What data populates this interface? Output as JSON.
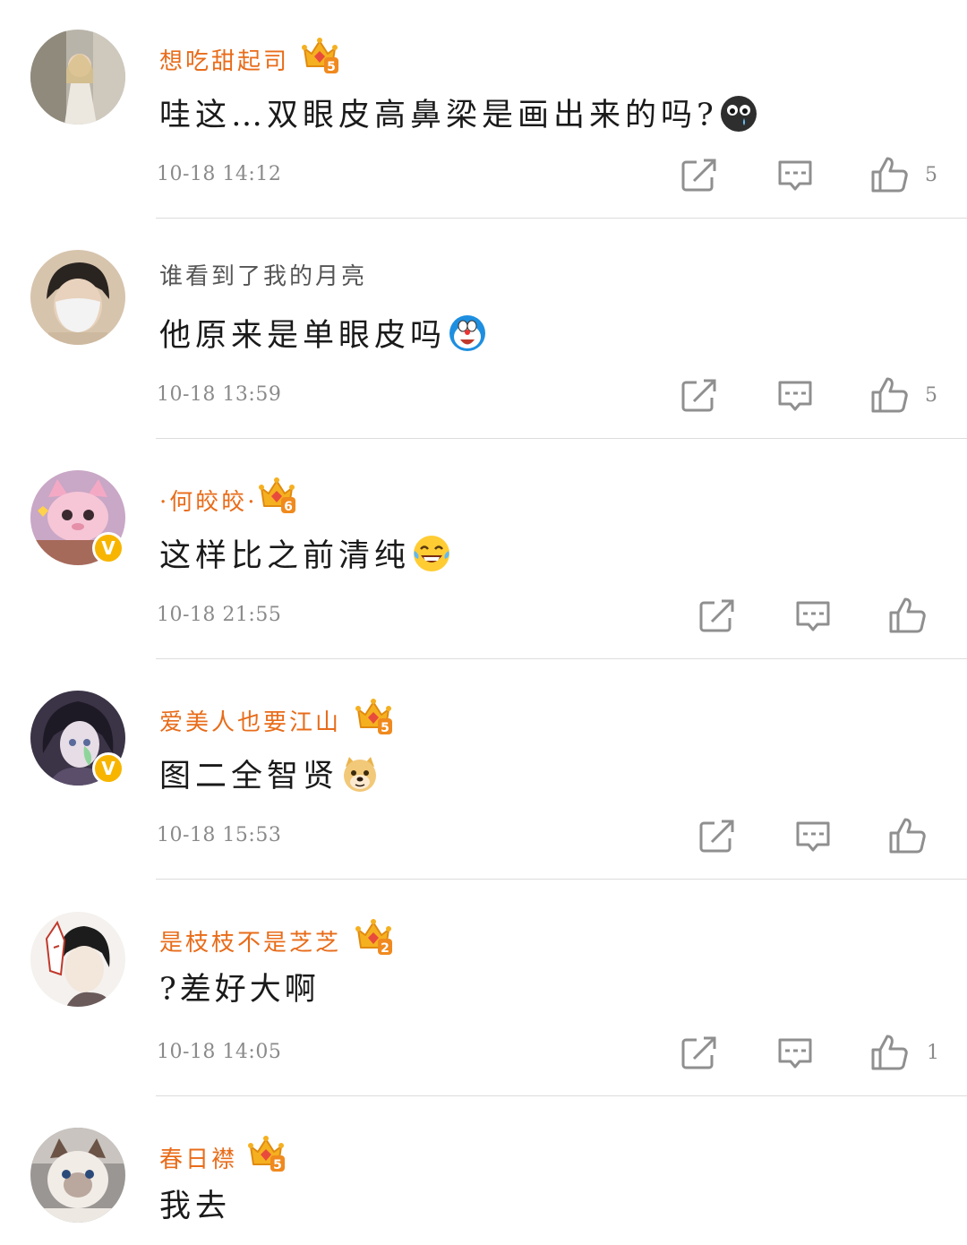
{
  "comments": [
    {
      "username": "想吃甜起司",
      "vip_level": "5",
      "text": "哇这…双眼皮高鼻梁是画出来的吗?",
      "emoji": "crying-face-emoji",
      "time": "10-18 14:12",
      "likes": "5"
    },
    {
      "username": "谁看到了我的月亮",
      "text": "他原来是单眼皮吗",
      "emoji": "doraemon-emoji",
      "time": "10-18 13:59",
      "likes": "5"
    },
    {
      "username": "·何皎皎·",
      "vip_level": "6",
      "verified": true,
      "text": "这样比之前清纯",
      "emoji": "laughing-tears-emoji",
      "time": "10-18 21:55",
      "likes": ""
    },
    {
      "username": "爱美人也要江山",
      "vip_level": "5",
      "verified": true,
      "text": "图二全智贤",
      "emoji": "doge-emoji",
      "time": "10-18 15:53",
      "likes": ""
    },
    {
      "username": "是枝枝不是芝芝",
      "vip_level": "2",
      "text": "?差好大啊",
      "time": "10-18 14:05",
      "likes": "1"
    },
    {
      "username": "春日襟",
      "vip_level": "5",
      "text": "我去"
    }
  ],
  "icons": {
    "repost": "repost-icon",
    "reply": "comment-icon",
    "like": "thumbs-up-icon",
    "vip": "crown-badge-icon",
    "verified": "verified-badge-icon"
  },
  "colors": {
    "vip_name": "#e86c1a",
    "plain_name": "#555555",
    "meta": "#8a8a8a",
    "verified": "#f7b500",
    "divider": "#dcdcdc"
  },
  "verified_mark": "V"
}
